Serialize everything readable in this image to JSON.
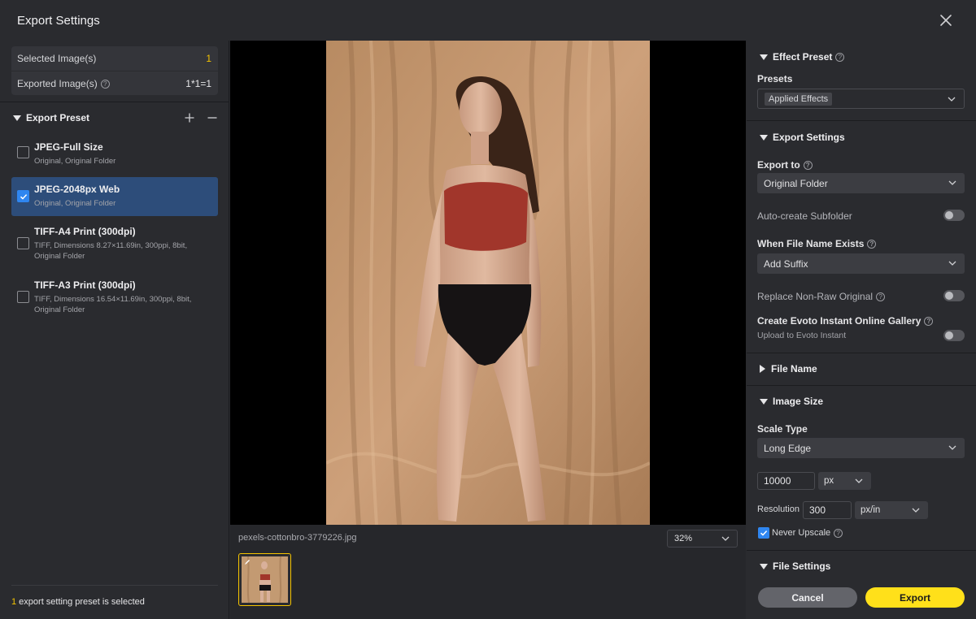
{
  "window": {
    "title": "Export Settings"
  },
  "stats": {
    "selected_label": "Selected Image(s)",
    "selected_value": "1",
    "exported_label": "Exported Image(s)",
    "exported_value": "1*1=1"
  },
  "export_preset": {
    "title": "Export Preset",
    "items": [
      {
        "name": "JPEG-Full Size",
        "desc": "Original, Original Folder",
        "checked": false
      },
      {
        "name": "JPEG-2048px Web",
        "desc": "Original, Original Folder",
        "checked": true
      },
      {
        "name": "TIFF-A4 Print (300dpi)",
        "desc": "TIFF, Dimensions 8.27×11.69in, 300ppi, 8bit, Original Folder",
        "checked": false
      },
      {
        "name": "TIFF-A3 Print (300dpi)",
        "desc": "TIFF, Dimensions 16.54×11.69in, 300ppi, 8bit, Original Folder",
        "checked": false
      }
    ],
    "footer_count": "1",
    "footer_text": " export setting preset is selected"
  },
  "preview": {
    "filename": "pexels-cottonbro-3779226.jpg",
    "zoom": "32%"
  },
  "effect_preset": {
    "title": "Effect Preset",
    "presets_label": "Presets",
    "presets_value": "Applied Effects"
  },
  "export_settings": {
    "title": "Export Settings",
    "export_to_label": "Export to",
    "export_to_value": "Original Folder",
    "auto_subfolder_label": "Auto-create Subfolder",
    "file_exists_label": "When File Name Exists",
    "file_exists_value": "Add Suffix",
    "replace_label": "Replace Non-Raw Original",
    "gallery_label": "Create Evoto Instant Online Gallery",
    "gallery_sub": "Upload to Evoto Instant"
  },
  "file_name": {
    "title": "File Name"
  },
  "image_size": {
    "title": "Image Size",
    "scale_type_label": "Scale Type",
    "scale_type_value": "Long Edge",
    "size_value": "10000",
    "size_unit": "px",
    "resolution_label": "Resolution",
    "resolution_value": "300",
    "resolution_unit": "px/in",
    "never_upscale_label": "Never Upscale"
  },
  "file_settings": {
    "title": "File Settings"
  },
  "actions": {
    "cancel": "Cancel",
    "export": "Export"
  },
  "colors": {
    "accent_yellow": "#ffe01a",
    "selection_blue": "#2d4d7a",
    "checkbox_blue": "#2f86f0"
  }
}
